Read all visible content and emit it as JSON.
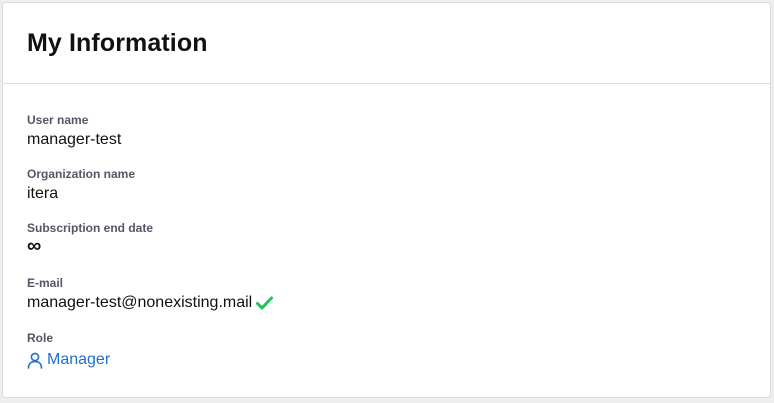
{
  "header": {
    "title": "My Information"
  },
  "fields": {
    "username": {
      "label": "User name",
      "value": "manager-test"
    },
    "organization": {
      "label": "Organization name",
      "value": "itera"
    },
    "subscription": {
      "label": "Subscription end date",
      "value": "∞"
    },
    "email": {
      "label": "E-mail",
      "value": "manager-test@nonexisting.mail",
      "verified_icon": "checkmark-icon"
    },
    "role": {
      "label": "Role",
      "value": "Manager",
      "icon": "user-icon"
    }
  },
  "colors": {
    "link": "#1f6fcf",
    "verified": "#1ec45a",
    "label": "#555566"
  }
}
